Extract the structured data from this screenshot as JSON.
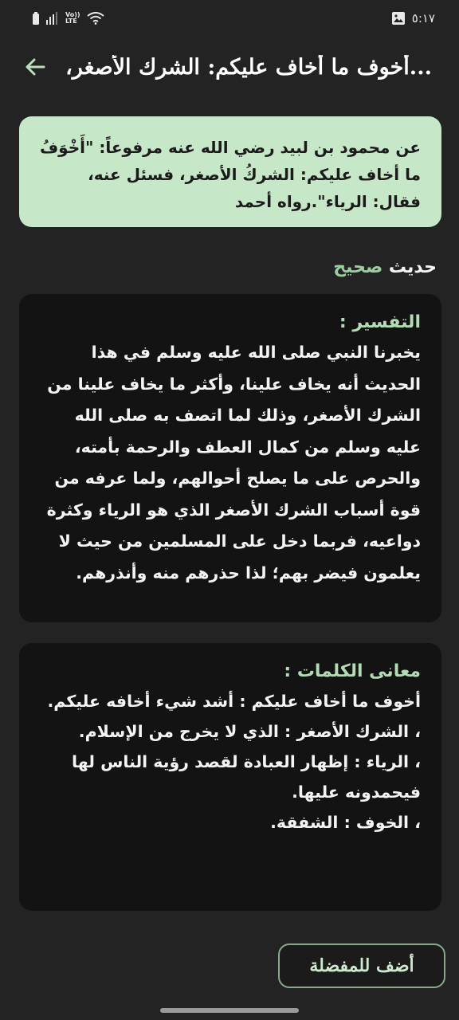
{
  "status_bar": {
    "time": "٥:١٧",
    "network_label_top": "Vo))",
    "network_label_bottom": "LTE"
  },
  "header": {
    "title": "...أخوف ما أخاف عليكم: الشرك الأصغر، ف"
  },
  "hadith": {
    "text": "عن محمود بن لبيد رضي الله عنه مرفوعاً: \"أَخْوَفُ ما أخاف عليكم: الشركُ الأصغر، فسئل عنه، فقال: الرياء\".رواه أحمد"
  },
  "grade": {
    "label": "حديث",
    "value": "صحيح"
  },
  "tafsir": {
    "heading": "التفسير :",
    "body": "يخبرنا النبي صلى الله عليه وسلم في هذا الحديث أنه يخاف علينا، وأكثر ما يخاف علينا من الشرك الأصغر، وذلك لما اتصف به صلى الله عليه وسلم من كمال العطف والرحمة بأمته، والحرص على ما يصلح أحوالهم، ولما عرفه من قوة أسباب الشرك الأصغر الذي هو الرياء وكثرة دواعيه، فربما دخل على المسلمين من حيث لا يعلمون فيضر بهم؛ لذا حذرهم منه وأنذرهم."
  },
  "meanings": {
    "heading": "معانى الكلمات :",
    "items": [
      "أخوف ما أخاف عليكم :  أشد شيء أخافه عليكم.",
      "، الشرك الأصغر :  الذي لا يخرج من الإسلام.",
      "، الرياء :  إظهار العبادة لقصد رؤية الناس لها فيحمدونه عليها.",
      "، الخوف :  الشفقة."
    ]
  },
  "actions": {
    "favorite_label": "أضف للمفضلة"
  },
  "colors": {
    "background": "#232323",
    "hadith_card": "#c7e7c9",
    "accent_green": "#9ccf9e",
    "dark_card": "#131313"
  }
}
